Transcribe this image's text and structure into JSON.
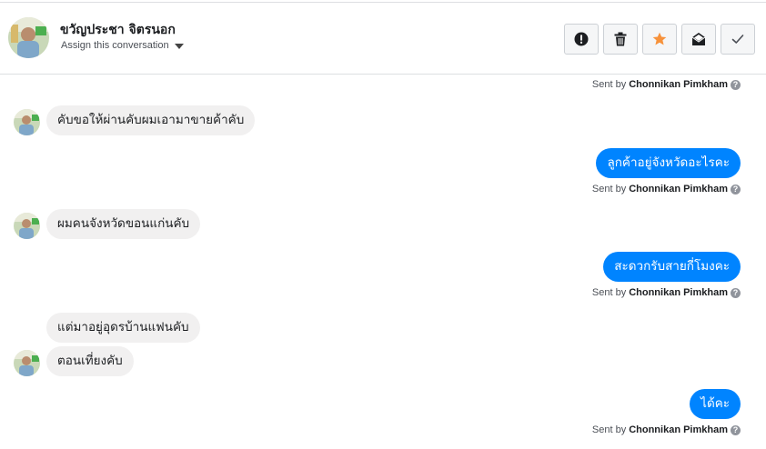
{
  "header": {
    "contact_name": "ขวัญประชา จิตรนอก",
    "assign_label": "Assign this conversation"
  },
  "actions": [
    {
      "name": "mark-spam-button",
      "icon": "alert-icon"
    },
    {
      "name": "delete-button",
      "icon": "trash-icon"
    },
    {
      "name": "star-button",
      "icon": "star-icon",
      "color": "#f7923b"
    },
    {
      "name": "mark-unread-button",
      "icon": "envelope-icon"
    },
    {
      "name": "mark-done-button",
      "icon": "checkmark-icon"
    }
  ],
  "sent_by": {
    "prefix": "Sent by",
    "agent": "Chonnikan Pimkham",
    "help_glyph": "?"
  },
  "messages": [
    {
      "direction": "in",
      "text": "คับขอให้ผ่านคับผมเอามาขายค้าคับ"
    },
    {
      "direction": "out",
      "text": "ลูกค้าอยู่จังหวัดอะไรคะ"
    },
    {
      "direction": "in",
      "text": "ผมคนจังหวัดขอนแก่นคับ"
    },
    {
      "direction": "out",
      "text": "สะดวกรับสายกี่โมงคะ"
    },
    {
      "direction": "in",
      "text": "แต่มาอยู่อุดรบ้านแฟนคับ"
    },
    {
      "direction": "in",
      "text": "ตอนเที่ยงคับ"
    },
    {
      "direction": "out",
      "text": "ได้คะ"
    }
  ],
  "colors": {
    "outgoing_bubble": "#0084ff",
    "incoming_bubble": "#f1f0f0",
    "star": "#f7923b"
  }
}
